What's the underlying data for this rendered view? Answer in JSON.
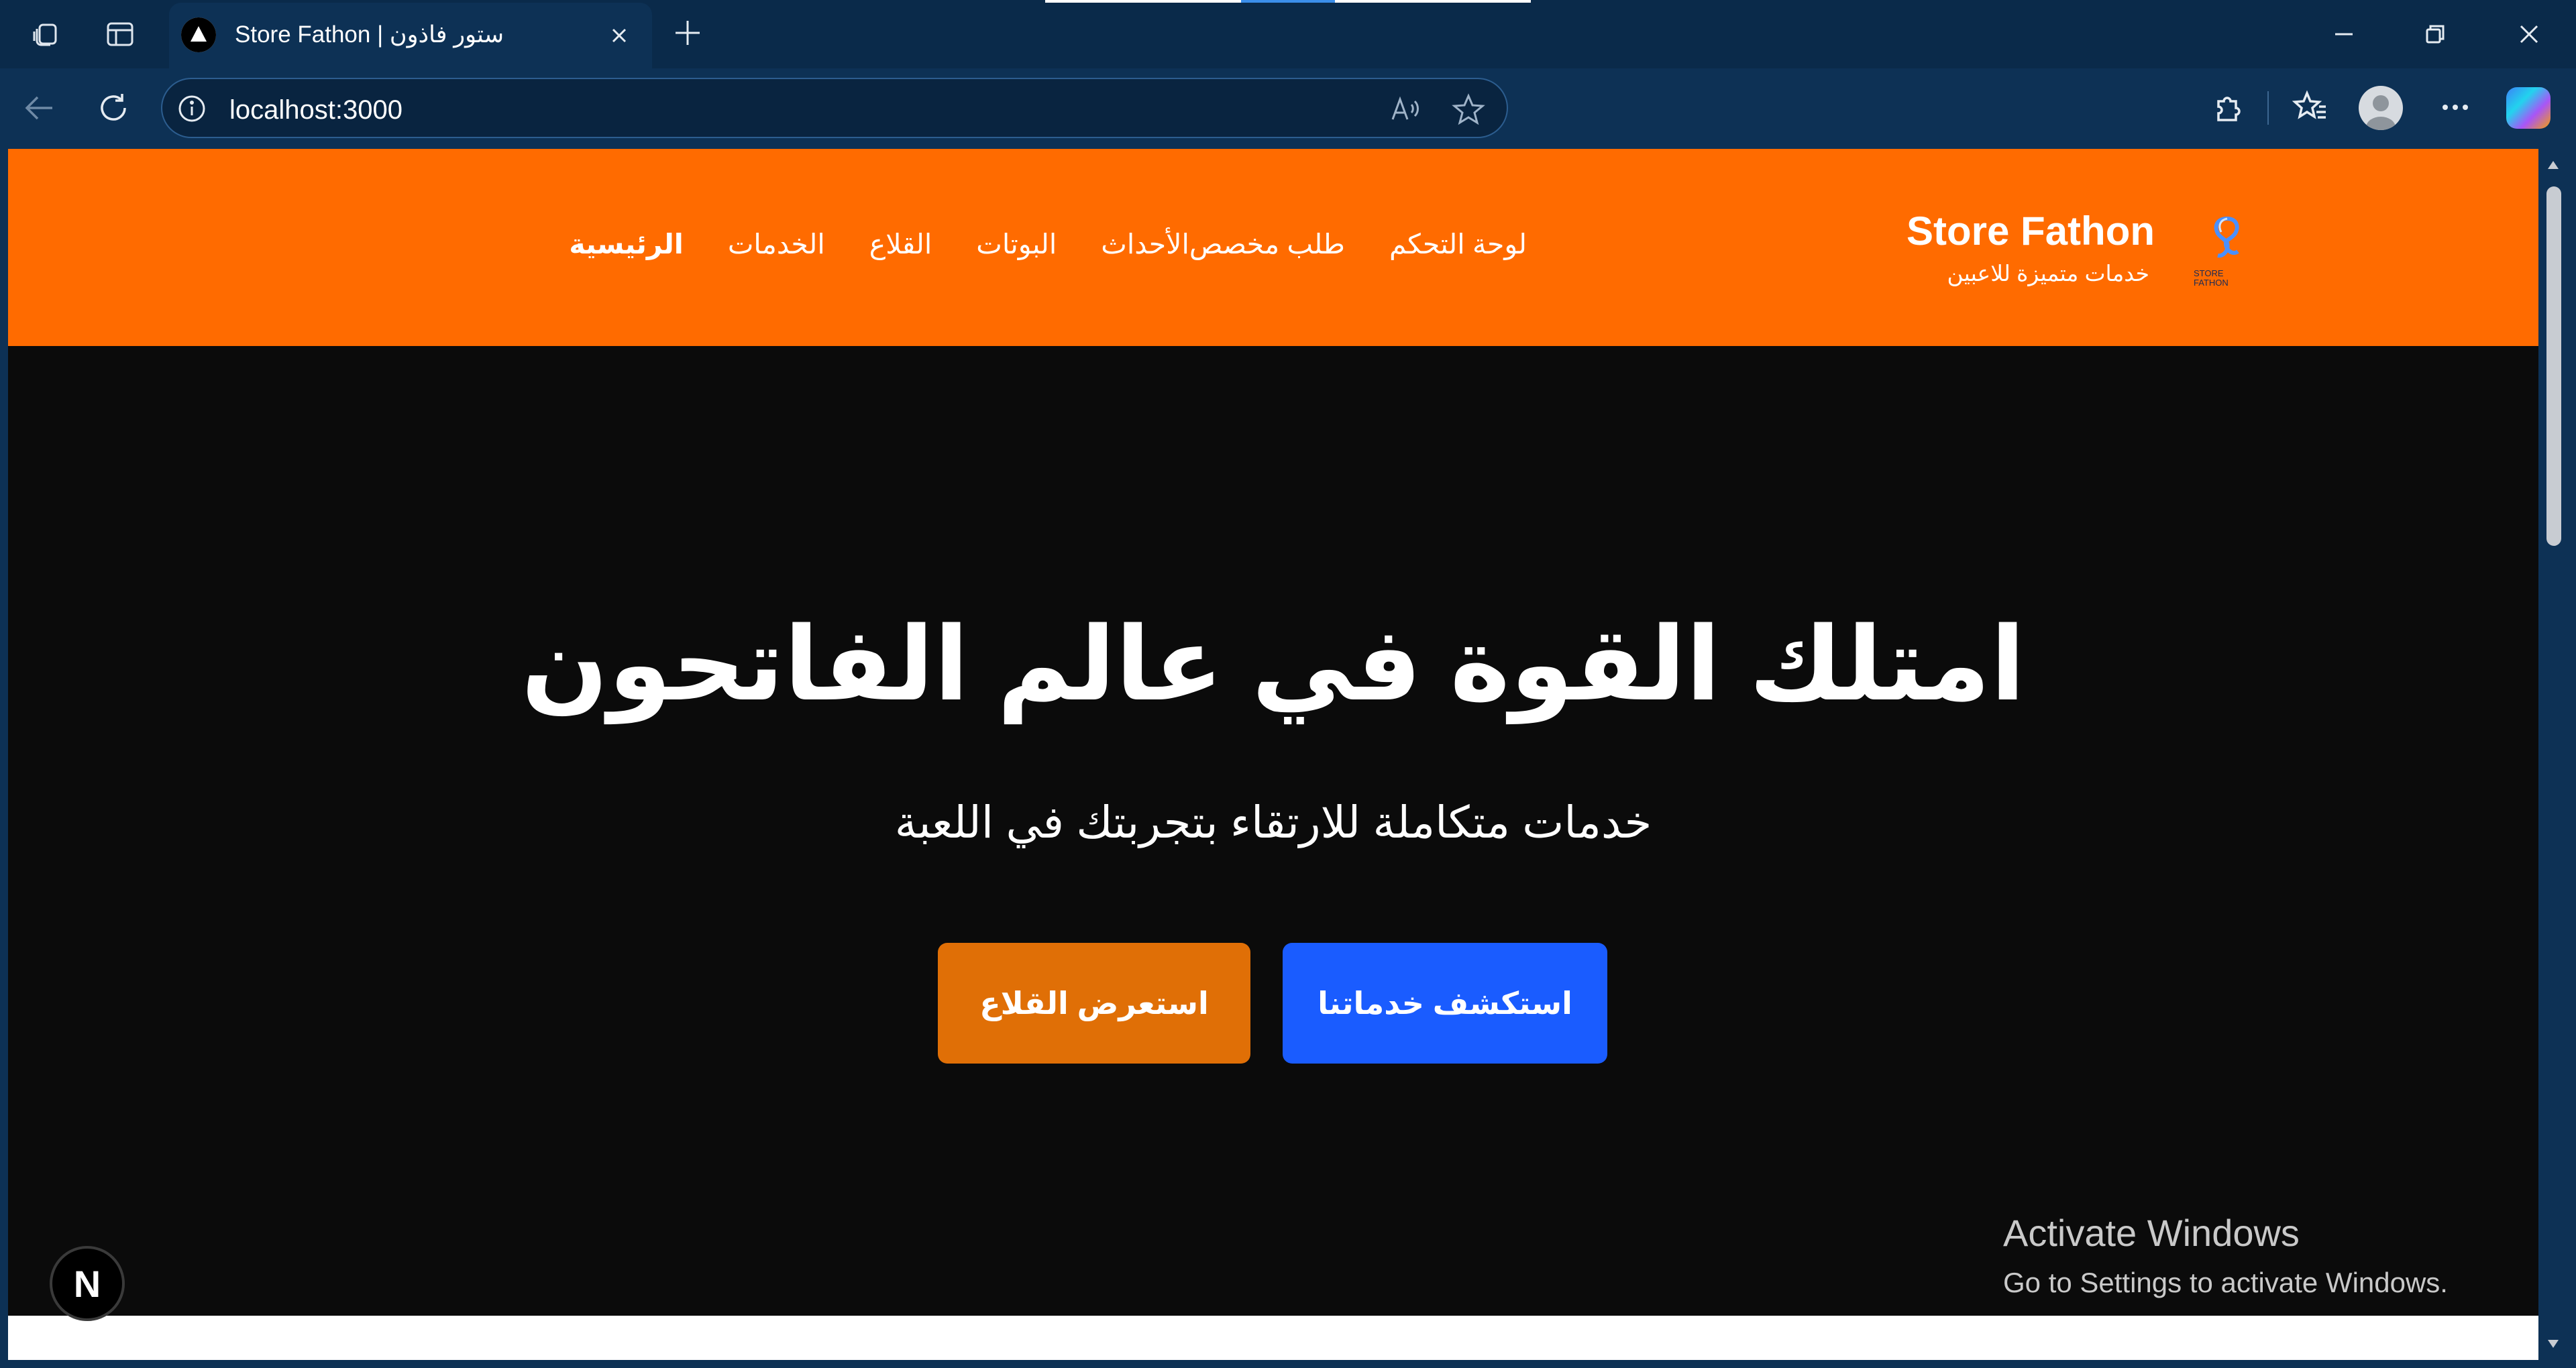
{
  "browser": {
    "tab_title": "Store Fathon | ستور فاذون",
    "address": "localhost:3000",
    "icons": [
      "workspaces-icon",
      "tab-actions-icon",
      "back-icon",
      "refresh-icon",
      "info-icon",
      "read-aloud-icon",
      "favorite-star-icon",
      "extensions-icon",
      "favorites-icon",
      "profile-icon",
      "more-icon",
      "copilot-icon"
    ]
  },
  "site": {
    "brand_name": "Store Fathon",
    "tagline": "خدمات متميزة للاعبين",
    "logo_text": [
      "STORE",
      "FATHON"
    ],
    "nav": [
      {
        "label": "الرئيسية",
        "active": true
      },
      {
        "label": "الخدمات"
      },
      {
        "label": "القلاع"
      },
      {
        "label": "البوتات"
      },
      {
        "label": "الأحداث"
      },
      {
        "label": "طلب مخصص"
      },
      {
        "label": "لوحة التحكم"
      }
    ],
    "colors": {
      "header": "#ff6b00",
      "primary_button": "#1a5cff",
      "secondary_button": "#e06f06",
      "background": "#0b0b0b"
    }
  },
  "hero": {
    "title": "امتلك القوة في عالم الفاتحون",
    "subtitle": "خدمات متكاملة للارتقاء بتجربتك في اللعبة",
    "cta_primary": "استكشف خدماتنا",
    "cta_secondary": "استعرض القلاع"
  },
  "overlays": {
    "next_badge": "N",
    "activate_title": "Activate Windows",
    "activate_subtitle": "Go to Settings to activate Windows."
  }
}
